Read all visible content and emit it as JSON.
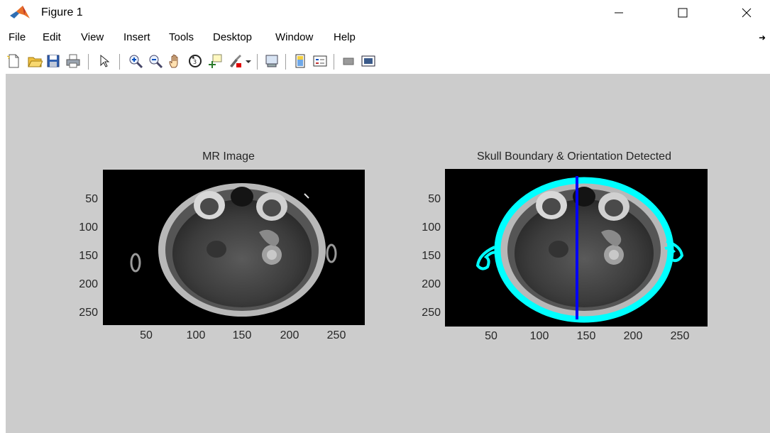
{
  "window": {
    "title": "Figure 1",
    "minimize_glyph": "—",
    "maximize_glyph": "☐",
    "close_glyph": "✕"
  },
  "menu": {
    "items": [
      "File",
      "Edit",
      "View",
      "Insert",
      "Tools",
      "Desktop",
      "Window",
      "Help"
    ]
  },
  "toolbar": {
    "buttons": [
      "new-figure-icon",
      "open-file-icon",
      "save-figure-icon",
      "print-figure-icon",
      "edit-plot-arrow-icon",
      "zoom-in-icon",
      "zoom-out-icon",
      "pan-hand-icon",
      "rotate-3d-icon",
      "data-cursor-icon",
      "brush-icon",
      "brush-dropdown-icon",
      "link-plot-icon",
      "insert-colorbar-icon",
      "insert-legend-icon",
      "hide-plot-tools-icon",
      "show-plot-tools-icon"
    ]
  },
  "plots": [
    {
      "title": "MR Image",
      "yticks": [
        "50",
        "100",
        "150",
        "200",
        "250"
      ],
      "xticks": [
        "50",
        "100",
        "150",
        "200",
        "250"
      ],
      "overlay": false
    },
    {
      "title": "Skull Boundary & Orientation Detected",
      "yticks": [
        "50",
        "100",
        "150",
        "200",
        "250"
      ],
      "xticks": [
        "50",
        "100",
        "150",
        "200",
        "250"
      ],
      "overlay": true,
      "boundary_color": "#00ffff",
      "orientation_line_color": "#0000ff"
    }
  ],
  "colors": {
    "figure_background": "#cccccc",
    "axes_background": "#000000",
    "skull_boundary": "#00ffff",
    "orientation_line": "#0000ff"
  }
}
